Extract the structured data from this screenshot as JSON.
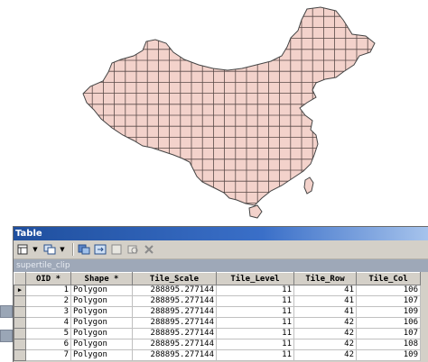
{
  "window": {
    "title": "Table",
    "layer_name": "supertile_clip"
  },
  "toolbar": {
    "icons": [
      "table-options-icon",
      "related-tables-icon",
      "select-by-attributes-icon",
      "switch-selection-icon",
      "clear-selection-icon",
      "zoom-to-selected-icon",
      "delete-selected-icon"
    ]
  },
  "table": {
    "columns": [
      "OID *",
      "Shape *",
      "Tile_Scale",
      "Tile_Level",
      "Tile_Row",
      "Tile_Col"
    ],
    "rows": [
      [
        "1",
        "Polygon",
        "288895.277144",
        "11",
        "41",
        "106"
      ],
      [
        "2",
        "Polygon",
        "288895.277144",
        "11",
        "41",
        "107"
      ],
      [
        "3",
        "Polygon",
        "288895.277144",
        "11",
        "41",
        "109"
      ],
      [
        "4",
        "Polygon",
        "288895.277144",
        "11",
        "42",
        "106"
      ],
      [
        "5",
        "Polygon",
        "288895.277144",
        "11",
        "42",
        "107"
      ],
      [
        "6",
        "Polygon",
        "288895.277144",
        "11",
        "42",
        "108"
      ],
      [
        "7",
        "Polygon",
        "288895.277144",
        "11",
        "42",
        "109"
      ]
    ],
    "current_row_indicator": "▶"
  },
  "map": {
    "fill_color": "#f3d2cb",
    "grid_color": "#5a4a48",
    "outline_color": "#444444"
  }
}
